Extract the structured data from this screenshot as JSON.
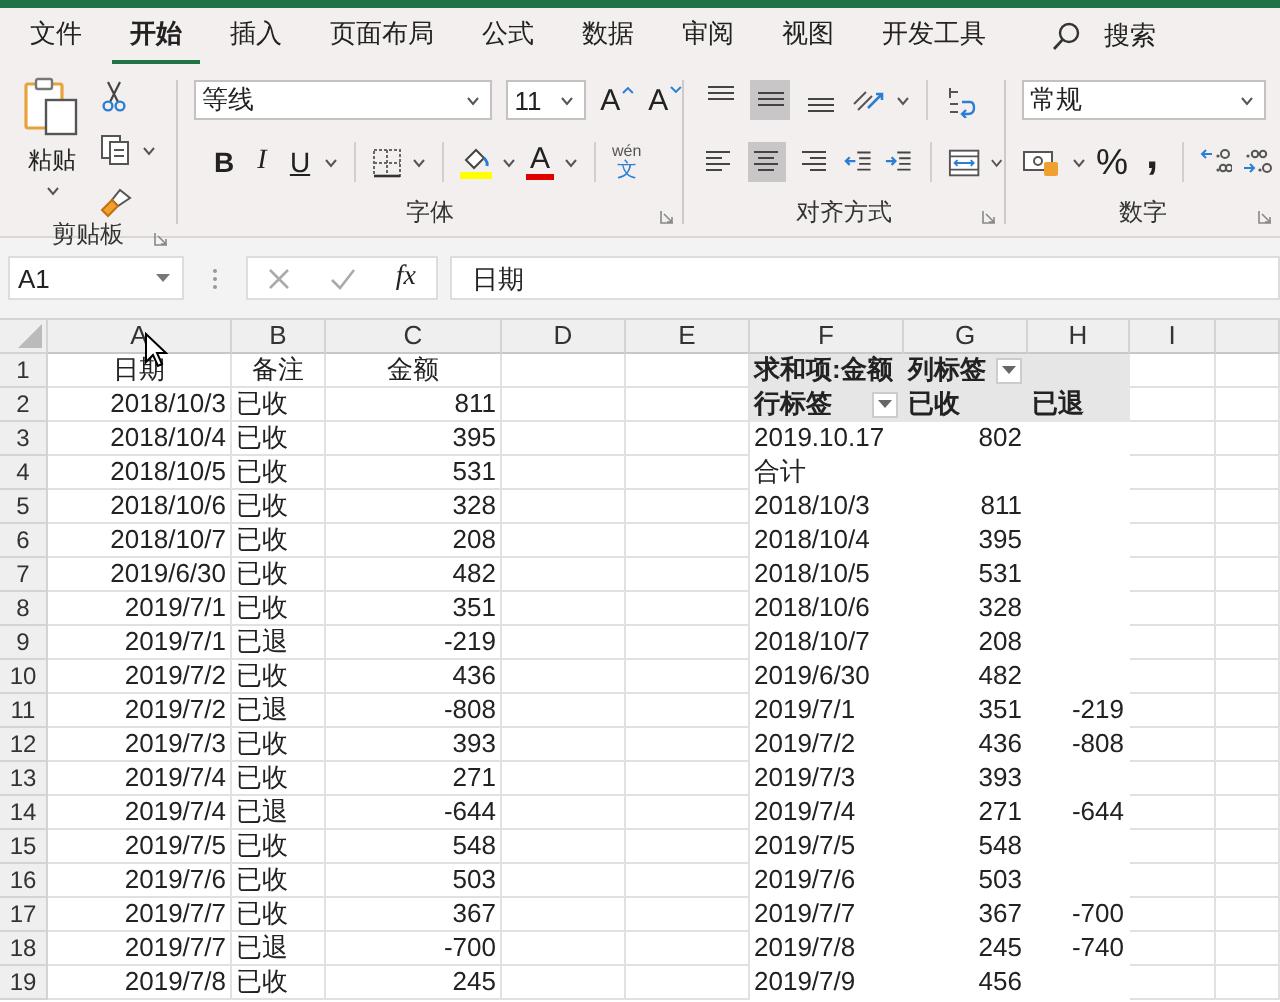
{
  "tabs": [
    {
      "label": "文件",
      "selected": false
    },
    {
      "label": "开始",
      "selected": true
    },
    {
      "label": "插入",
      "selected": false
    },
    {
      "label": "页面布局",
      "selected": false
    },
    {
      "label": "公式",
      "selected": false
    },
    {
      "label": "数据",
      "selected": false
    },
    {
      "label": "审阅",
      "selected": false
    },
    {
      "label": "视图",
      "selected": false
    },
    {
      "label": "开发工具",
      "selected": false
    }
  ],
  "search": {
    "label": "搜索"
  },
  "ribbon": {
    "clipboard": {
      "title": "剪贴板",
      "paste": "粘贴"
    },
    "font": {
      "title": "字体",
      "name": "等线",
      "size": "11",
      "grow": "A",
      "shrink": "A",
      "bold": "B",
      "italic": "I",
      "underline": "U",
      "color_letter": "A",
      "phonetic_top": "wén",
      "phonetic_bottom": "文"
    },
    "alignment": {
      "title": "对齐方式",
      "vertical": [
        {
          "selected": false
        },
        {
          "selected": true
        },
        {
          "selected": false
        }
      ],
      "horizontal": [
        {
          "selected": false
        },
        {
          "selected": true
        },
        {
          "selected": false
        }
      ]
    },
    "number": {
      "title": "数字",
      "format": "常规",
      "percent": "%",
      "comma": ","
    }
  },
  "formula_bar": {
    "name_box": "A1",
    "function_label": "fx",
    "content": "日期"
  },
  "sheet": {
    "columns": [
      "A",
      "B",
      "C",
      "D",
      "E",
      "F",
      "G",
      "H",
      "I"
    ],
    "rows": [
      {
        "number": "1",
        "cells": [
          "日期",
          "备注",
          "金额"
        ]
      },
      {
        "number": "2",
        "cells": [
          "2018/10/3",
          "已收",
          "811"
        ]
      },
      {
        "number": "3",
        "cells": [
          "2018/10/4",
          "已收",
          "395"
        ]
      },
      {
        "number": "4",
        "cells": [
          "2018/10/5",
          "已收",
          "531"
        ]
      },
      {
        "number": "5",
        "cells": [
          "2018/10/6",
          "已收",
          "328"
        ]
      },
      {
        "number": "6",
        "cells": [
          "2018/10/7",
          "已收",
          "208"
        ]
      },
      {
        "number": "7",
        "cells": [
          "2019/6/30",
          "已收",
          "482"
        ]
      },
      {
        "number": "8",
        "cells": [
          "2019/7/1",
          "已收",
          "351"
        ]
      },
      {
        "number": "9",
        "cells": [
          "2019/7/1",
          "已退",
          "-219"
        ]
      },
      {
        "number": "10",
        "cells": [
          "2019/7/2",
          "已收",
          "436"
        ]
      },
      {
        "number": "11",
        "cells": [
          "2019/7/2",
          "已退",
          "-808"
        ]
      },
      {
        "number": "12",
        "cells": [
          "2019/7/3",
          "已收",
          "393"
        ]
      },
      {
        "number": "13",
        "cells": [
          "2019/7/4",
          "已收",
          "271"
        ]
      },
      {
        "number": "14",
        "cells": [
          "2019/7/4",
          "已退",
          "-644"
        ]
      },
      {
        "number": "15",
        "cells": [
          "2019/7/5",
          "已收",
          "548"
        ]
      },
      {
        "number": "16",
        "cells": [
          "2019/7/6",
          "已收",
          "503"
        ]
      },
      {
        "number": "17",
        "cells": [
          "2019/7/7",
          "已收",
          "367"
        ]
      },
      {
        "number": "18",
        "cells": [
          "2019/7/7",
          "已退",
          "-700"
        ]
      },
      {
        "number": "19",
        "cells": [
          "2019/7/8",
          "已收",
          "245"
        ]
      }
    ]
  },
  "pivot": {
    "value_field": "求和项:金额",
    "column_labels": "列标签",
    "row_labels": "行标签",
    "column_items": [
      "已收",
      "已退"
    ],
    "rows": [
      {
        "label": "2019.10.17",
        "values": [
          "802"
        ]
      },
      {
        "label": "合计",
        "values": []
      },
      {
        "label": "2018/10/3",
        "values": [
          "811"
        ]
      },
      {
        "label": "2018/10/4",
        "values": [
          "395"
        ]
      },
      {
        "label": "2018/10/5",
        "values": [
          "531"
        ]
      },
      {
        "label": "2018/10/6",
        "values": [
          "328"
        ]
      },
      {
        "label": "2018/10/7",
        "values": [
          "208"
        ]
      },
      {
        "label": "2019/6/30",
        "values": [
          "482"
        ]
      },
      {
        "label": "2019/7/1",
        "values": [
          "351",
          "-219"
        ]
      },
      {
        "label": "2019/7/2",
        "values": [
          "436",
          "-808"
        ]
      },
      {
        "label": "2019/7/3",
        "values": [
          "393"
        ]
      },
      {
        "label": "2019/7/4",
        "values": [
          "271",
          "-644"
        ]
      },
      {
        "label": "2019/7/5",
        "values": [
          "548"
        ]
      },
      {
        "label": "2019/7/6",
        "values": [
          "503"
        ]
      },
      {
        "label": "2019/7/7",
        "values": [
          "367",
          "-700"
        ]
      },
      {
        "label": "2019/7/8",
        "values": [
          "245",
          "-740"
        ]
      },
      {
        "label": "2019/7/9",
        "values": [
          "456"
        ]
      }
    ]
  }
}
